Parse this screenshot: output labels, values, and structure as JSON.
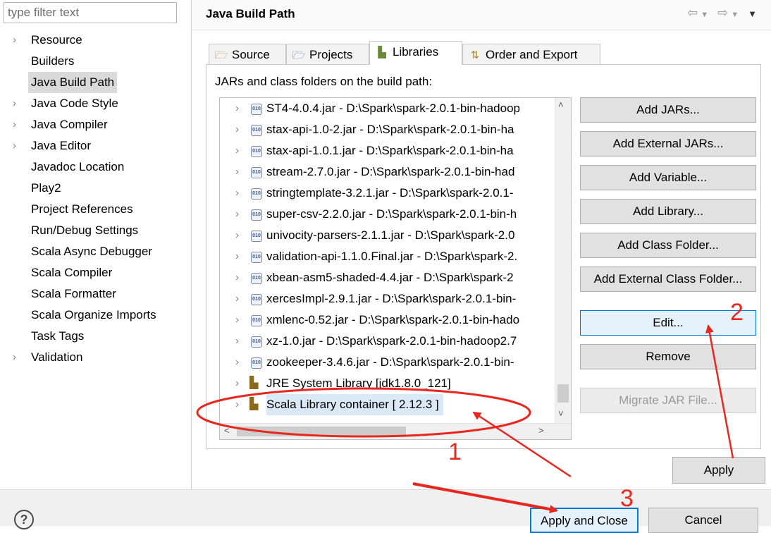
{
  "sidebar": {
    "filter_placeholder": "type filter text",
    "items": [
      {
        "label": "Resource",
        "expandable": true
      },
      {
        "label": "Builders",
        "expandable": false
      },
      {
        "label": "Java Build Path",
        "expandable": false,
        "selected": true
      },
      {
        "label": "Java Code Style",
        "expandable": true
      },
      {
        "label": "Java Compiler",
        "expandable": true
      },
      {
        "label": "Java Editor",
        "expandable": true
      },
      {
        "label": "Javadoc Location",
        "expandable": false
      },
      {
        "label": "Play2",
        "expandable": false
      },
      {
        "label": "Project References",
        "expandable": false
      },
      {
        "label": "Run/Debug Settings",
        "expandable": false
      },
      {
        "label": "Scala Async Debugger",
        "expandable": false
      },
      {
        "label": "Scala Compiler",
        "expandable": false
      },
      {
        "label": "Scala Formatter",
        "expandable": false
      },
      {
        "label": "Scala Organize Imports",
        "expandable": false
      },
      {
        "label": "Task Tags",
        "expandable": false
      },
      {
        "label": "Validation",
        "expandable": true
      }
    ]
  },
  "header": {
    "title": "Java Build Path",
    "nav_icons": [
      "back-arrow-icon",
      "dropdown-icon",
      "forward-arrow-icon",
      "dropdown-icon",
      "menu-icon"
    ]
  },
  "tabs": [
    {
      "label": "Source",
      "icon": "source-folder-icon"
    },
    {
      "label": "Projects",
      "icon": "projects-icon"
    },
    {
      "label": "Libraries",
      "icon": "libraries-icon",
      "active": true
    },
    {
      "label": "Order and Export",
      "icon": "order-export-icon"
    }
  ],
  "libraries": {
    "panel_label": "JARs and class folders on the build path:",
    "entries": [
      {
        "text": "ST4-4.0.4.jar - D:\\Spark\\spark-2.0.1-bin-hadoop",
        "type": "jar"
      },
      {
        "text": "stax-api-1.0-2.jar - D:\\Spark\\spark-2.0.1-bin-ha",
        "type": "jar"
      },
      {
        "text": "stax-api-1.0.1.jar - D:\\Spark\\spark-2.0.1-bin-ha",
        "type": "jar"
      },
      {
        "text": "stream-2.7.0.jar - D:\\Spark\\spark-2.0.1-bin-had",
        "type": "jar"
      },
      {
        "text": "stringtemplate-3.2.1.jar - D:\\Spark\\spark-2.0.1-",
        "type": "jar"
      },
      {
        "text": "super-csv-2.2.0.jar - D:\\Spark\\spark-2.0.1-bin-h",
        "type": "jar"
      },
      {
        "text": "univocity-parsers-2.1.1.jar - D:\\Spark\\spark-2.0",
        "type": "jar"
      },
      {
        "text": "validation-api-1.1.0.Final.jar - D:\\Spark\\spark-2.",
        "type": "jar"
      },
      {
        "text": "xbean-asm5-shaded-4.4.jar - D:\\Spark\\spark-2",
        "type": "jar"
      },
      {
        "text": "xercesImpl-2.9.1.jar - D:\\Spark\\spark-2.0.1-bin-",
        "type": "jar"
      },
      {
        "text": "xmlenc-0.52.jar - D:\\Spark\\spark-2.0.1-bin-hado",
        "type": "jar"
      },
      {
        "text": "xz-1.0.jar - D:\\Spark\\spark-2.0.1-bin-hadoop2.7",
        "type": "jar"
      },
      {
        "text": "zookeeper-3.4.6.jar - D:\\Spark\\spark-2.0.1-bin-",
        "type": "jar"
      },
      {
        "text": "JRE System Library [jdk1.8.0_121]",
        "type": "library"
      },
      {
        "text": "Scala Library container [ 2.12.3 ]",
        "type": "library",
        "selected": true
      }
    ]
  },
  "buttons": {
    "add_jars": "Add JARs...",
    "add_external_jars": "Add External JARs...",
    "add_variable": "Add Variable...",
    "add_library": "Add Library...",
    "add_class_folder": "Add Class Folder...",
    "add_external_class_folder": "Add External Class Folder...",
    "edit": "Edit...",
    "remove": "Remove",
    "migrate_jar": "Migrate JAR File...",
    "apply": "Apply"
  },
  "footer": {
    "help_icon": "?",
    "apply_and_close": "Apply and Close",
    "cancel": "Cancel"
  },
  "annotations": {
    "color": "#e8271f",
    "step_1": "1",
    "step_2": "2",
    "step_3": "3"
  }
}
